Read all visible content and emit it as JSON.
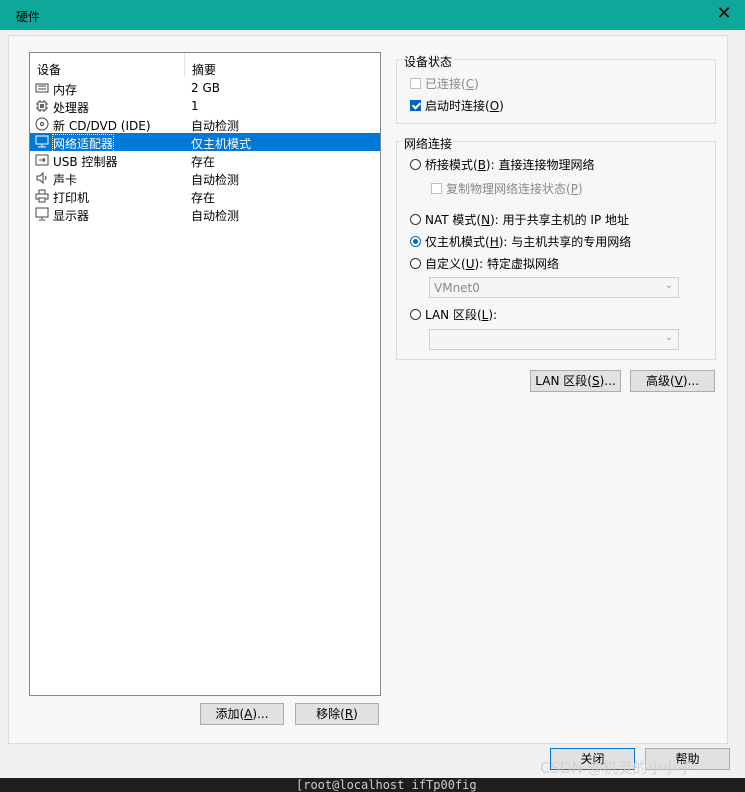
{
  "window": {
    "title": "硬件",
    "close_glyph": "✕"
  },
  "device_list": {
    "headers": {
      "device": "设备",
      "summary": "摘要"
    },
    "rows": [
      {
        "name": "内存",
        "summary": "2 GB",
        "icon": "memory-icon"
      },
      {
        "name": "处理器",
        "summary": "1",
        "icon": "cpu-icon"
      },
      {
        "name": "新 CD/DVD (IDE)",
        "summary": "自动检测",
        "icon": "cd-icon"
      },
      {
        "name": "网络适配器",
        "summary": "仅主机模式",
        "icon": "network-icon",
        "selected": true
      },
      {
        "name": "USB 控制器",
        "summary": "存在",
        "icon": "usb-icon"
      },
      {
        "name": "声卡",
        "summary": "自动检测",
        "icon": "sound-icon"
      },
      {
        "name": "打印机",
        "summary": "存在",
        "icon": "printer-icon"
      },
      {
        "name": "显示器",
        "summary": "自动检测",
        "icon": "display-icon"
      }
    ]
  },
  "buttons": {
    "add": {
      "text": "添加(",
      "key": "A",
      "tail": ")..."
    },
    "remove": {
      "text": "移除(",
      "key": "R",
      "tail": ")"
    },
    "lan_segments": {
      "text": "LAN 区段(",
      "key": "S",
      "tail": ")..."
    },
    "advanced": {
      "text": "高级(",
      "key": "V",
      "tail": ")..."
    },
    "close": "关闭",
    "help": "帮助"
  },
  "device_status": {
    "label": "设备状态",
    "connected": {
      "text": "已连接(",
      "key": "C",
      "tail": ")",
      "checked": false,
      "enabled": false
    },
    "connect_at_power_on": {
      "text": "启动时连接(",
      "key": "O",
      "tail": ")",
      "checked": true
    }
  },
  "network_connection": {
    "label": "网络连接",
    "bridged": {
      "text": "桥接模式(",
      "key": "B",
      "tail": "): 直接连接物理网络",
      "selected": false
    },
    "replicate": {
      "text": "复制物理网络连接状态(",
      "key": "P",
      "tail": ")",
      "checked": false
    },
    "nat": {
      "text": "NAT 模式(",
      "key": "N",
      "tail": "): 用于共享主机的 IP 地址",
      "selected": false
    },
    "host_only": {
      "text": "仅主机模式(",
      "key": "H",
      "tail": "): 与主机共享的专用网络",
      "selected": true
    },
    "custom": {
      "text": "自定义(",
      "key": "U",
      "tail": "): 特定虚拟网络",
      "selected": false
    },
    "custom_value": "VMnet0",
    "lan_segment": {
      "text": "LAN 区段(",
      "key": "L",
      "tail": "):",
      "selected": false
    },
    "lan_value": ""
  },
  "background": {
    "terminal_text": "[root@localhost ifTp00fig",
    "watermark": "CSDN @机灵的小小子"
  },
  "colors": {
    "titlebar": "#0ea89a",
    "selection": "#0078d7",
    "accent": "#0067c0"
  }
}
